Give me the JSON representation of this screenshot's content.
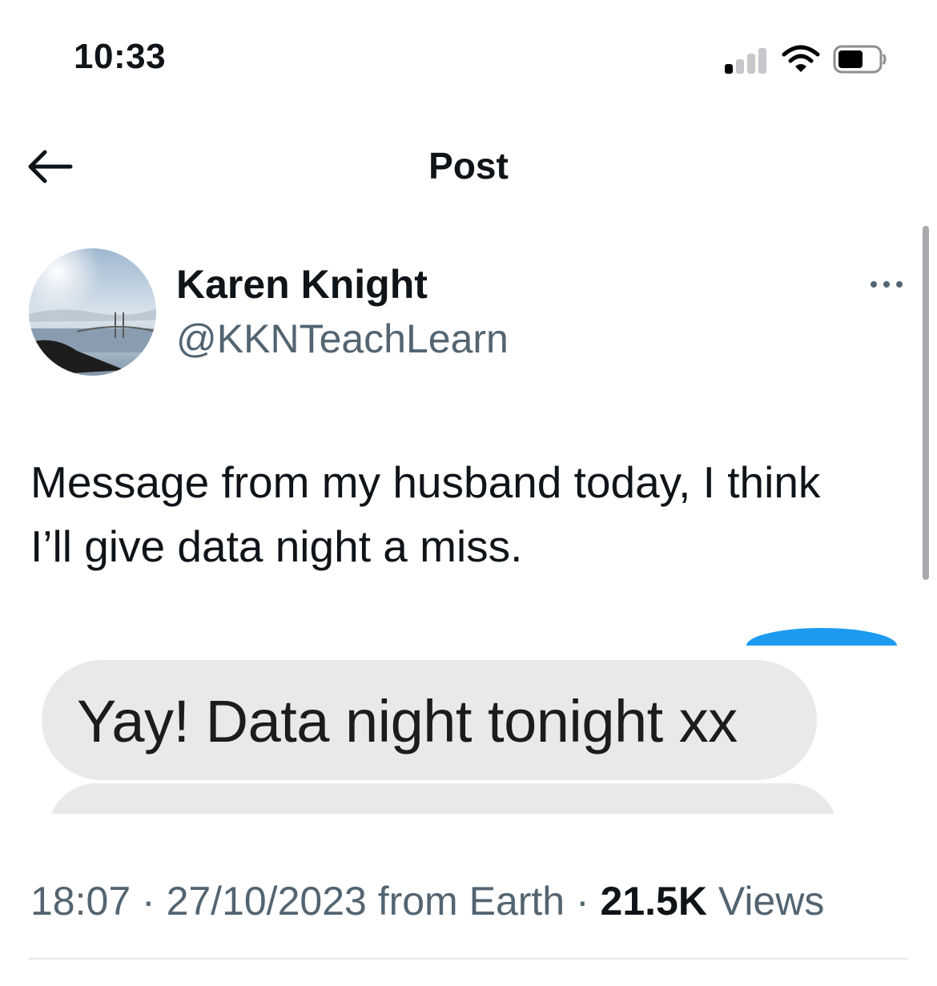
{
  "status_bar": {
    "time": "10:33"
  },
  "header": {
    "title": "Post"
  },
  "author": {
    "name": "Karen Knight",
    "handle": "@KKNTeachLearn"
  },
  "tweet": {
    "text_line1": "Message from my husband today, I think",
    "text_line2": "I’ll give data night a miss."
  },
  "media": {
    "bubble_text": "Yay! Data night tonight xx"
  },
  "meta": {
    "time": "18:07",
    "sep1": " · ",
    "date": "27/10/2023",
    "source": " from Earth",
    "sep2": " · ",
    "views_count": "21.5K",
    "views_label": " Views"
  },
  "colors": {
    "accent": "#1d9bf0",
    "text": "#0f1419",
    "muted": "#536471",
    "bubble": "#e9e9eb"
  },
  "icons": {
    "back": "arrow-left-icon",
    "more": "more-horizontal-icon"
  }
}
